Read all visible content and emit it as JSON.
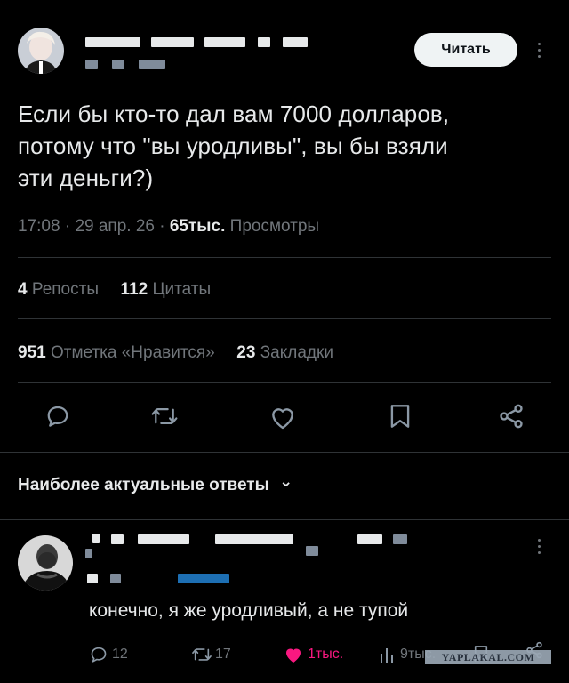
{
  "post": {
    "follow_label": "Читать",
    "text_lines": [
      "Если бы кто-то дал вам 7000 долларов,",
      "потому что \"вы уродливы\", вы бы взяли",
      "эти деньги?)"
    ],
    "time": "17:08",
    "date": "29 апр. 26",
    "views_count": "65тыс.",
    "views_label": "Просмотры",
    "sep": "·"
  },
  "stats": {
    "reposts_count": "4",
    "reposts_label": "Репосты",
    "quotes_count": "112",
    "quotes_label": "Цитаты",
    "likes_count": "951",
    "likes_label": "Отметка «Нравится»",
    "bookmarks_count": "23",
    "bookmarks_label": "Закладки"
  },
  "replies_header": {
    "label": "Наиболее актуальные ответы",
    "chevron": "⌄"
  },
  "reply": {
    "text": "конечно, я же уродливый, а не тупой",
    "replies_count": "12",
    "reposts_count": "17",
    "likes_count": "1тыс.",
    "views_count": "9тыс.",
    "watermark": "YAPLAKAL.COM"
  },
  "colors": {
    "background": "#000000",
    "text": "#e7e9ea",
    "muted": "#71767b",
    "like_pink": "#f91880",
    "divider": "#2f3336"
  },
  "icons": [
    "reply-icon",
    "repost-icon",
    "like-icon",
    "bookmark-icon",
    "share-icon",
    "kebab-icon",
    "chevron-down-icon",
    "views-icon"
  ]
}
